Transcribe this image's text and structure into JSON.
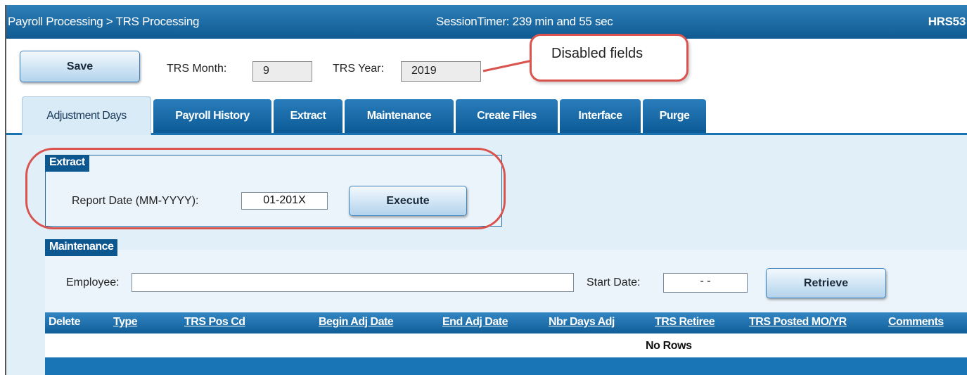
{
  "header": {
    "breadcrumb": "Payroll Processing > TRS Processing",
    "session_timer": "SessionTimer: 239 min and 55 sec",
    "screen_code": "HRS53"
  },
  "toolbar": {
    "save_label": "Save",
    "trs_month_label": "TRS Month:",
    "trs_month_value": "9",
    "trs_year_label": "TRS Year:",
    "trs_year_value": "2019"
  },
  "callout": {
    "text": "Disabled fields"
  },
  "tabs": [
    {
      "label": "Adjustment Days",
      "active": true
    },
    {
      "label": "Payroll History",
      "active": false
    },
    {
      "label": "Extract",
      "active": false
    },
    {
      "label": "Maintenance",
      "active": false
    },
    {
      "label": "Create Files",
      "active": false
    },
    {
      "label": "Interface",
      "active": false
    },
    {
      "label": "Purge",
      "active": false
    }
  ],
  "extract": {
    "title": "Extract",
    "report_date_label": "Report Date (MM-YYYY):",
    "report_date_value": "01-201X",
    "execute_label": "Execute"
  },
  "maintenance": {
    "title": "Maintenance",
    "employee_label": "Employee:",
    "employee_value": "",
    "start_date_label": "Start Date:",
    "start_date_value": "- -",
    "retrieve_label": "Retrieve"
  },
  "grid": {
    "columns": [
      "Delete",
      "Type",
      "TRS Pos Cd",
      "Begin Adj Date",
      "End Adj Date",
      "Nbr Days Adj",
      "TRS Retiree",
      "TRS Posted MO/YR",
      "Comments"
    ],
    "empty_text": "No Rows"
  },
  "colors": {
    "header_blue": "#0f5a93",
    "callout_red": "#d9534f",
    "panel_bg": "#e0eff8"
  }
}
